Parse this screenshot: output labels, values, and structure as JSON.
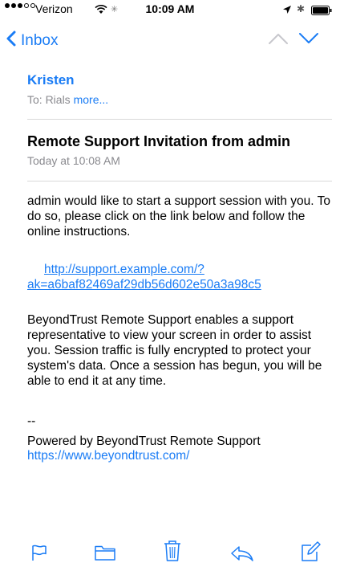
{
  "status_bar": {
    "carrier": "Verizon",
    "time": "10:09 AM"
  },
  "nav": {
    "back_label": "Inbox"
  },
  "message": {
    "sender": "Kristen",
    "to_prefix": "To: Rials",
    "to_more": "more...",
    "subject": "Remote Support Invitation from admin",
    "date": "Today at 10:08 AM",
    "paragraph1": "admin would like to start a support session with you. To do so, please click on the link below and follow the online instructions.",
    "link_line1": "http://support.example.com/?",
    "link_line2": "ak=a6baf82469af29db56d602e50a3a98c5",
    "paragraph2": "BeyondTrust Remote Support enables a support representative to view your screen in order to assist you. Session traffic is fully encrypted to protect your system's data. Once a session has begun, you will be able to end it at any time.",
    "signature_dashes": "--",
    "powered_by": "Powered by BeyondTrust Remote Support",
    "site_link": "https://www.beyondtrust.com/"
  },
  "colors": {
    "accent": "#1a7cf5",
    "secondary_text": "#8a8a8f"
  },
  "icons": {
    "toolbar": [
      "flag-icon",
      "folder-icon",
      "trash-icon",
      "reply-icon",
      "compose-icon"
    ]
  }
}
